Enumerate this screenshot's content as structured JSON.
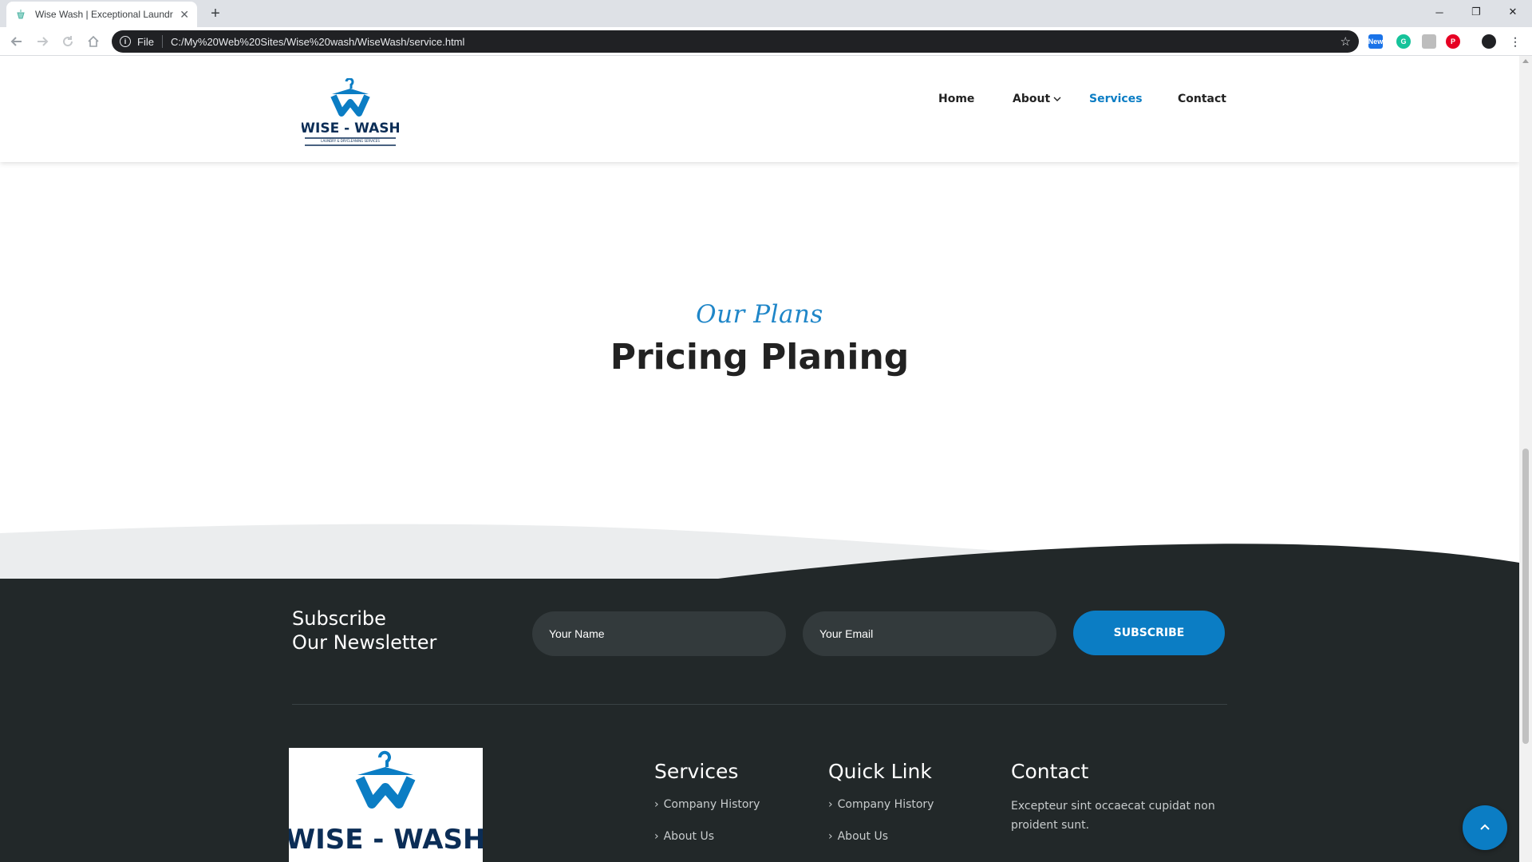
{
  "browser": {
    "tab_title": "Wise Wash | Exceptional Laundry",
    "tab_close": "✕",
    "new_tab": "+",
    "scheme_label": "File",
    "url": "C:/My%20Web%20Sites/Wise%20wash/WiseWash/service.html",
    "bookmark_star": "☆",
    "window_controls": {
      "minimize": "─",
      "restore": "❐",
      "close": "✕"
    },
    "extensions": [
      {
        "icon": "news-extension-icon",
        "color": "#1a73e8",
        "label": "New"
      },
      {
        "icon": "grammar-extension-icon",
        "color": "#15c39a",
        "label": "G"
      },
      {
        "icon": "gray-extension-icon",
        "color": "#bdbdbd",
        "label": ""
      },
      {
        "icon": "pinterest-icon",
        "color": "#e60023",
        "label": "P"
      },
      {
        "icon": "profile-avatar-icon",
        "color": "#202124",
        "label": ""
      }
    ]
  },
  "site": {
    "logo_text": "WISE - WASH",
    "logo_tagline": "LAUNDRY & DRYCLEANING SERVICES",
    "brand_color": "#0b7dc4",
    "nav": [
      {
        "label": "Home",
        "active": false
      },
      {
        "label": "About",
        "active": false,
        "has_dropdown": true
      },
      {
        "label": "Services",
        "active": true
      },
      {
        "label": "Contact",
        "active": false
      }
    ],
    "plans_subtitle": "Our Plans",
    "plans_title": "Pricing Planing"
  },
  "footer": {
    "newsletter_title_line1": "Subscribe",
    "newsletter_title_line2": "Our Newsletter",
    "name_placeholder": "Your Name",
    "email_placeholder": "Your Email",
    "subscribe_label": "SUBSCRIBE",
    "logo_text": "WISE - WASH",
    "services_title": "Services",
    "services_links": [
      "Company History",
      "About Us"
    ],
    "quick_title": "Quick Link",
    "quick_links": [
      "Company History",
      "About Us"
    ],
    "contact_title": "Contact",
    "contact_text": "Excepteur sint occaecat cupidat non proident sunt."
  }
}
